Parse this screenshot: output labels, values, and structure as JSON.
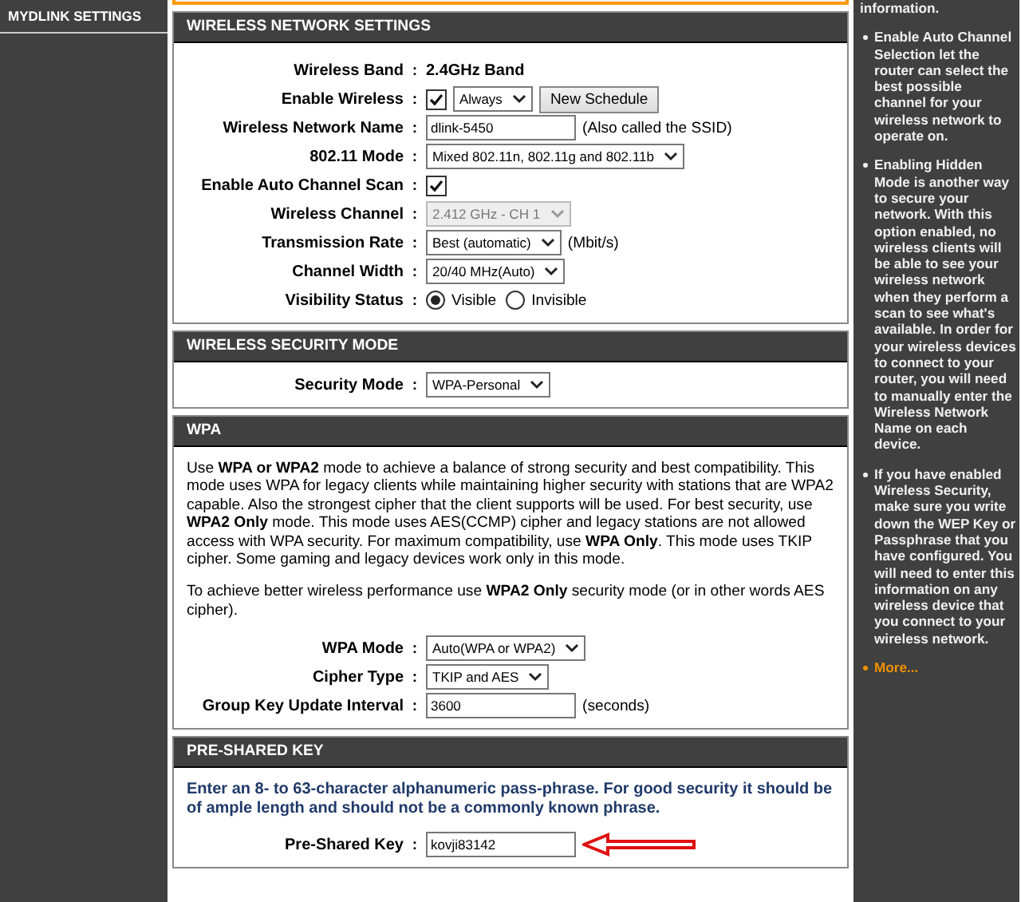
{
  "sidebar": {
    "items": [
      {
        "label": "MYDLINK SETTINGS",
        "selected": false
      }
    ]
  },
  "sections": [
    {
      "title": "WIRELESS NETWORK SETTINGS",
      "rows": [
        {
          "label": "Wireless Band",
          "separator": ":",
          "controls": [
            {
              "kind": "text",
              "value": "2.4GHz Band"
            }
          ]
        },
        {
          "label": "Enable Wireless",
          "separator": ":",
          "controls": [
            {
              "kind": "checkbox",
              "checked": true
            },
            {
              "kind": "select",
              "value": "Always",
              "disabled": false
            },
            {
              "kind": "button",
              "value": "New Schedule"
            }
          ]
        },
        {
          "label": "Wireless Network Name",
          "separator": ":",
          "controls": [
            {
              "kind": "input",
              "value": "dlink-5450"
            },
            {
              "kind": "note",
              "value": "(Also called the SSID)"
            }
          ]
        },
        {
          "label": "802.11 Mode",
          "separator": ":",
          "controls": [
            {
              "kind": "select",
              "value": "Mixed 802.11n, 802.11g and 802.11b",
              "disabled": false
            }
          ]
        },
        {
          "label": "Enable Auto Channel Scan",
          "separator": ":",
          "controls": [
            {
              "kind": "checkbox",
              "checked": true
            }
          ]
        },
        {
          "label": "Wireless Channel",
          "separator": ":",
          "controls": [
            {
              "kind": "select",
              "value": "2.412 GHz - CH 1",
              "disabled": true
            }
          ]
        },
        {
          "label": "Transmission Rate",
          "separator": ":",
          "controls": [
            {
              "kind": "select",
              "value": "Best (automatic)",
              "disabled": false
            },
            {
              "kind": "note",
              "value": "(Mbit/s)"
            }
          ]
        },
        {
          "label": "Channel Width",
          "separator": ":",
          "controls": [
            {
              "kind": "select",
              "value": "20/40 MHz(Auto)",
              "disabled": false
            }
          ]
        },
        {
          "label": "Visibility Status",
          "separator": ":",
          "controls": [
            {
              "kind": "radio",
              "value": "Visible",
              "selected": true
            },
            {
              "kind": "radio",
              "value": "Invisible",
              "selected": false
            }
          ]
        }
      ]
    },
    {
      "title": "WIRELESS SECURITY MODE",
      "rows": [
        {
          "label": "Security Mode",
          "separator": ":",
          "controls": [
            {
              "kind": "select",
              "value": "WPA-Personal",
              "disabled": false
            }
          ]
        }
      ]
    },
    {
      "title": "WPA",
      "paragraphs": [
        {
          "kind": "plain",
          "text": "Use **WPA or WPA2** mode to achieve a balance of strong security and best compatibility. This mode uses WPA for legacy clients while maintaining higher security with stations that are WPA2 capable. Also the strongest cipher that the client supports will be used. For best security, use **WPA2 Only** mode. This mode uses AES(CCMP) cipher and legacy stations are not allowed access with WPA security. For maximum compatibility, use **WPA Only**. This mode uses TKIP cipher. Some gaming and legacy devices work only in this mode."
        },
        {
          "kind": "plain",
          "text": "To achieve better wireless performance use **WPA2 Only** security mode (or in other words AES cipher)."
        }
      ],
      "rows": [
        {
          "label": "WPA Mode",
          "separator": ":",
          "controls": [
            {
              "kind": "select",
              "value": "Auto(WPA or WPA2)",
              "disabled": false
            }
          ]
        },
        {
          "label": "Cipher Type",
          "separator": ":",
          "controls": [
            {
              "kind": "select",
              "value": "TKIP and AES",
              "disabled": false
            }
          ]
        },
        {
          "label": "Group Key Update Interval",
          "separator": ":",
          "controls": [
            {
              "kind": "input",
              "value": "3600"
            },
            {
              "kind": "note",
              "value": "(seconds)"
            }
          ]
        }
      ]
    },
    {
      "title": "PRE-SHARED KEY",
      "paragraphs": [
        {
          "kind": "notice",
          "text": "Enter an 8- to 63-character alphanumeric pass-phrase. For good security it should be of ample length and should not be a commonly known phrase."
        }
      ],
      "rows": [
        {
          "label": "Pre-Shared Key",
          "separator": ":",
          "controls": [
            {
              "kind": "input",
              "value": "kovji83142"
            },
            {
              "kind": "arrow"
            }
          ]
        }
      ]
    }
  ],
  "help": {
    "intro": "information.",
    "tips": [
      "Enable Auto Channel Selection let the router can select the best possible channel for your wireless network to operate on.",
      "Enabling Hidden Mode is another way to secure your network. With this option enabled, no wireless clients will be able to see your wireless network when they perform a scan to see what's available. In order for your wireless devices to connect to your router, you will need to manually enter the Wireless Network Name on each device.",
      "If you have enabled Wireless Security, make sure you write down the WEP Key or Passphrase that you have configured. You will need to enter this information on any wireless device that you connect to your wireless network."
    ],
    "more": "More..."
  }
}
